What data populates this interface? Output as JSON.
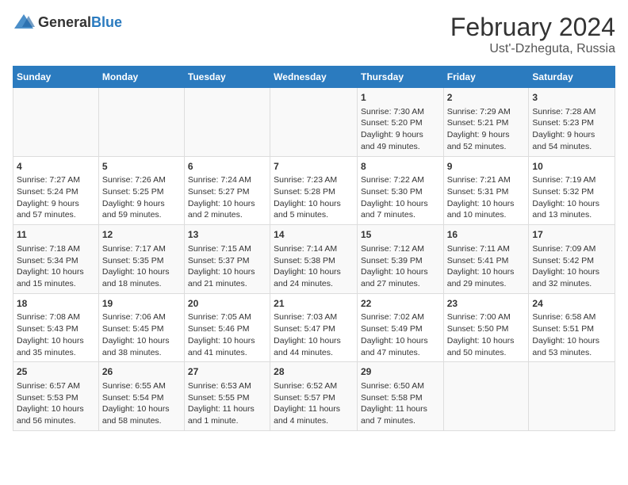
{
  "header": {
    "logo_general": "General",
    "logo_blue": "Blue",
    "month_year": "February 2024",
    "location": "Ust'-Dzheguta, Russia"
  },
  "days_of_week": [
    "Sunday",
    "Monday",
    "Tuesday",
    "Wednesday",
    "Thursday",
    "Friday",
    "Saturday"
  ],
  "weeks": [
    [
      {
        "day": "",
        "info": ""
      },
      {
        "day": "",
        "info": ""
      },
      {
        "day": "",
        "info": ""
      },
      {
        "day": "",
        "info": ""
      },
      {
        "day": "1",
        "info": "Sunrise: 7:30 AM\nSunset: 5:20 PM\nDaylight: 9 hours\nand 49 minutes."
      },
      {
        "day": "2",
        "info": "Sunrise: 7:29 AM\nSunset: 5:21 PM\nDaylight: 9 hours\nand 52 minutes."
      },
      {
        "day": "3",
        "info": "Sunrise: 7:28 AM\nSunset: 5:23 PM\nDaylight: 9 hours\nand 54 minutes."
      }
    ],
    [
      {
        "day": "4",
        "info": "Sunrise: 7:27 AM\nSunset: 5:24 PM\nDaylight: 9 hours\nand 57 minutes."
      },
      {
        "day": "5",
        "info": "Sunrise: 7:26 AM\nSunset: 5:25 PM\nDaylight: 9 hours\nand 59 minutes."
      },
      {
        "day": "6",
        "info": "Sunrise: 7:24 AM\nSunset: 5:27 PM\nDaylight: 10 hours\nand 2 minutes."
      },
      {
        "day": "7",
        "info": "Sunrise: 7:23 AM\nSunset: 5:28 PM\nDaylight: 10 hours\nand 5 minutes."
      },
      {
        "day": "8",
        "info": "Sunrise: 7:22 AM\nSunset: 5:30 PM\nDaylight: 10 hours\nand 7 minutes."
      },
      {
        "day": "9",
        "info": "Sunrise: 7:21 AM\nSunset: 5:31 PM\nDaylight: 10 hours\nand 10 minutes."
      },
      {
        "day": "10",
        "info": "Sunrise: 7:19 AM\nSunset: 5:32 PM\nDaylight: 10 hours\nand 13 minutes."
      }
    ],
    [
      {
        "day": "11",
        "info": "Sunrise: 7:18 AM\nSunset: 5:34 PM\nDaylight: 10 hours\nand 15 minutes."
      },
      {
        "day": "12",
        "info": "Sunrise: 7:17 AM\nSunset: 5:35 PM\nDaylight: 10 hours\nand 18 minutes."
      },
      {
        "day": "13",
        "info": "Sunrise: 7:15 AM\nSunset: 5:37 PM\nDaylight: 10 hours\nand 21 minutes."
      },
      {
        "day": "14",
        "info": "Sunrise: 7:14 AM\nSunset: 5:38 PM\nDaylight: 10 hours\nand 24 minutes."
      },
      {
        "day": "15",
        "info": "Sunrise: 7:12 AM\nSunset: 5:39 PM\nDaylight: 10 hours\nand 27 minutes."
      },
      {
        "day": "16",
        "info": "Sunrise: 7:11 AM\nSunset: 5:41 PM\nDaylight: 10 hours\nand 29 minutes."
      },
      {
        "day": "17",
        "info": "Sunrise: 7:09 AM\nSunset: 5:42 PM\nDaylight: 10 hours\nand 32 minutes."
      }
    ],
    [
      {
        "day": "18",
        "info": "Sunrise: 7:08 AM\nSunset: 5:43 PM\nDaylight: 10 hours\nand 35 minutes."
      },
      {
        "day": "19",
        "info": "Sunrise: 7:06 AM\nSunset: 5:45 PM\nDaylight: 10 hours\nand 38 minutes."
      },
      {
        "day": "20",
        "info": "Sunrise: 7:05 AM\nSunset: 5:46 PM\nDaylight: 10 hours\nand 41 minutes."
      },
      {
        "day": "21",
        "info": "Sunrise: 7:03 AM\nSunset: 5:47 PM\nDaylight: 10 hours\nand 44 minutes."
      },
      {
        "day": "22",
        "info": "Sunrise: 7:02 AM\nSunset: 5:49 PM\nDaylight: 10 hours\nand 47 minutes."
      },
      {
        "day": "23",
        "info": "Sunrise: 7:00 AM\nSunset: 5:50 PM\nDaylight: 10 hours\nand 50 minutes."
      },
      {
        "day": "24",
        "info": "Sunrise: 6:58 AM\nSunset: 5:51 PM\nDaylight: 10 hours\nand 53 minutes."
      }
    ],
    [
      {
        "day": "25",
        "info": "Sunrise: 6:57 AM\nSunset: 5:53 PM\nDaylight: 10 hours\nand 56 minutes."
      },
      {
        "day": "26",
        "info": "Sunrise: 6:55 AM\nSunset: 5:54 PM\nDaylight: 10 hours\nand 58 minutes."
      },
      {
        "day": "27",
        "info": "Sunrise: 6:53 AM\nSunset: 5:55 PM\nDaylight: 11 hours\nand 1 minute."
      },
      {
        "day": "28",
        "info": "Sunrise: 6:52 AM\nSunset: 5:57 PM\nDaylight: 11 hours\nand 4 minutes."
      },
      {
        "day": "29",
        "info": "Sunrise: 6:50 AM\nSunset: 5:58 PM\nDaylight: 11 hours\nand 7 minutes."
      },
      {
        "day": "",
        "info": ""
      },
      {
        "day": "",
        "info": ""
      }
    ]
  ]
}
